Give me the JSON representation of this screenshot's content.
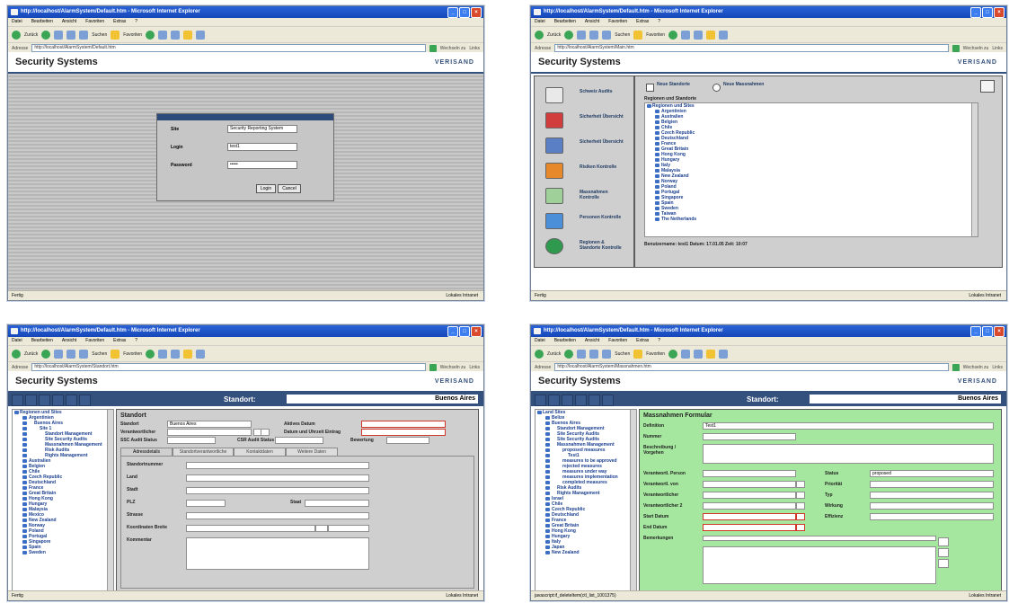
{
  "windows": [
    {
      "title": "http://localhost/AlarmSystem/Default.htm - Microsoft Internet Explorer",
      "menu": [
        "Datei",
        "Bearbeiten",
        "Ansicht",
        "Favoriten",
        "Extras",
        "?"
      ],
      "toolbar": {
        "back": "Zurück",
        "search": "Suchen",
        "favorites": "Favoriten"
      },
      "address_label": "Adresse",
      "address": "http://localhost/AlarmSystem/Default.htm",
      "go": "Wechseln zu",
      "links": "Links",
      "status_left": "Fertig",
      "status_right": "Lokales Intranet",
      "header_title": "Security Systems",
      "logo": "VERISAND",
      "login": {
        "site_label": "Site",
        "site_value": "Security Reporting System",
        "login_label": "Login",
        "login_value": "test1",
        "password_label": "Password",
        "password_value": "•••••",
        "login_btn": "Login",
        "cancel_btn": "Cancel"
      }
    },
    {
      "title": "http://localhost/AlarmSystem/Default.htm - Microsoft Internet Explorer",
      "menu": [
        "Datei",
        "Bearbeiten",
        "Ansicht",
        "Favoriten",
        "Extras",
        "?"
      ],
      "toolbar": {
        "back": "Zurück",
        "search": "Suchen",
        "favorites": "Favoriten"
      },
      "address_label": "Adresse",
      "address": "http://localhost/AlarmSystem/Main.htm",
      "go": "Wechseln zu",
      "links": "Links",
      "status_left": "Fertig",
      "status_right": "Lokales Intranet",
      "header_title": "Security Systems",
      "logo": "VERISAND",
      "nav": [
        "Schweiz Audits",
        "Sicherheit Übersicht",
        "Sicherheit Übersicht",
        "Risiken Kontrolle",
        "Massnahmen Kontrolle",
        "Personen Kontrolle",
        "Regionen & Standorte Kontrolle"
      ],
      "radio1": "Neue Standorte",
      "radio2": "Neue Massnahmen",
      "tree_heading": "Regionen und Standorte",
      "tree": [
        "Regionen und Sites",
        "Argentinien",
        "Australien",
        "Belgien",
        "Chile",
        "Czech Republic",
        "Deutschland",
        "France",
        "Great Britain",
        "Hong Kong",
        "Hungary",
        "Italy",
        "Malaysia",
        "New Zealand",
        "Norway",
        "Poland",
        "Portugal",
        "Singapore",
        "Spain",
        "Sweden",
        "Taiwan",
        "The Netherlands"
      ],
      "footer": "Benutzername: test1  Datum: 17.01.05  Zeit: 10:07"
    },
    {
      "title": "http://localhost/AlarmSystem/Default.htm - Microsoft Internet Explorer",
      "menu": [
        "Datei",
        "Bearbeiten",
        "Ansicht",
        "Favoriten",
        "Extras",
        "?"
      ],
      "toolbar": {
        "back": "Zurück",
        "search": "Suchen",
        "favorites": "Favoriten"
      },
      "address_label": "Adresse",
      "address": "http://localhost/AlarmSystem/Standort.htm",
      "go": "Wechseln zu",
      "links": "Links",
      "status_left": "Fertig",
      "status_right": "Lokales Intranet",
      "header_title": "Security Systems",
      "logo": "VERISAND",
      "standort_label": "Standort:",
      "standort_value": "Buenos Aires",
      "tree": [
        "Regionen und Sites",
        "Argentinien",
        "Buenos Aires",
        "Site 1",
        "Standort Management",
        "Site Security Audits",
        "Massnahmen Management",
        "Risk Audits",
        "Rights Management",
        "Australien",
        "Belgien",
        "Chile",
        "Czech Republic",
        "Deutschland",
        "France",
        "Great Britain",
        "Hong Kong",
        "Hungary",
        "Malaysia",
        "Mexico",
        "New Zealand",
        "Norway",
        "Poland",
        "Portugal",
        "Singapore",
        "Spain",
        "Sweden"
      ],
      "form_title": "Standort",
      "fields": {
        "standort": "Standort",
        "standort_value": "Buenos Aires",
        "verantwortlich": "Verantwortlicher",
        "ssc": "SSC Audit Status",
        "csr": "CSR Audit Status",
        "aktives": "Aktives Datum",
        "datum": "Datum und Uhrzeit Eintrag",
        "bewertung": "Bewertung"
      },
      "tabs": [
        "Adressdetails",
        "Standortverantwortliche",
        "Kontaktdaten",
        "Weitere Daten"
      ],
      "addr_fields": [
        "Standortnummer",
        "Land",
        "Stadt",
        "PLZ",
        "Strasse",
        "Koordinaten Breite",
        "Kommentar"
      ],
      "staat": "Staat"
    },
    {
      "title": "http://localhost/AlarmSystem/Default.htm - Microsoft Internet Explorer",
      "menu": [
        "Datei",
        "Bearbeiten",
        "Ansicht",
        "Favoriten",
        "Extras",
        "?"
      ],
      "toolbar": {
        "back": "Zurück",
        "search": "Suchen",
        "favorites": "Favoriten"
      },
      "address_label": "Adresse",
      "address": "http://localhost/AlarmSystem/Massnahmen.htm",
      "go": "Wechseln zu",
      "links": "Links",
      "status_left": "javascript:if_deleteItem(ctl_list_1001375)",
      "status_right": "Lokales Intranet",
      "header_title": "Security Systems",
      "logo": "VERISAND",
      "standort_label": "Standort:",
      "standort_value": "Buenos Aires",
      "tree": [
        "Land Sites",
        "Belize",
        "Buenos Aires",
        "Standort Management",
        "Site Security Audits",
        "Site Security Audits",
        "Massnahmen Management",
        "proposed measures",
        "Test1",
        "measures to be approved",
        "rejected measures",
        "measures under way",
        "measures implementation",
        "completed measures",
        "Risk Audits",
        "Rights Management",
        "Israel",
        "Chile",
        "Czech Republic",
        "Deutschland",
        "France",
        "Great Britain",
        "Hong Kong",
        "Hungary",
        "Italy",
        "Japan",
        "New Zealand"
      ],
      "form_title": "Massnahmen Formular",
      "left_labels": [
        "Definition",
        "Nummer",
        "Beschreibung / Vorgehen",
        "Verantwortl. Person",
        "Verantwortl. von",
        "Verantwortlicher",
        "Verantwortlicher 2",
        "Start Datum",
        "End Datum",
        "Bemerkungen"
      ],
      "right_labels": [
        "Status",
        "Priorität",
        "Typ",
        "Wirkung",
        "Effizienz"
      ],
      "definition_value": "Test1",
      "status_value": "proposed"
    }
  ]
}
